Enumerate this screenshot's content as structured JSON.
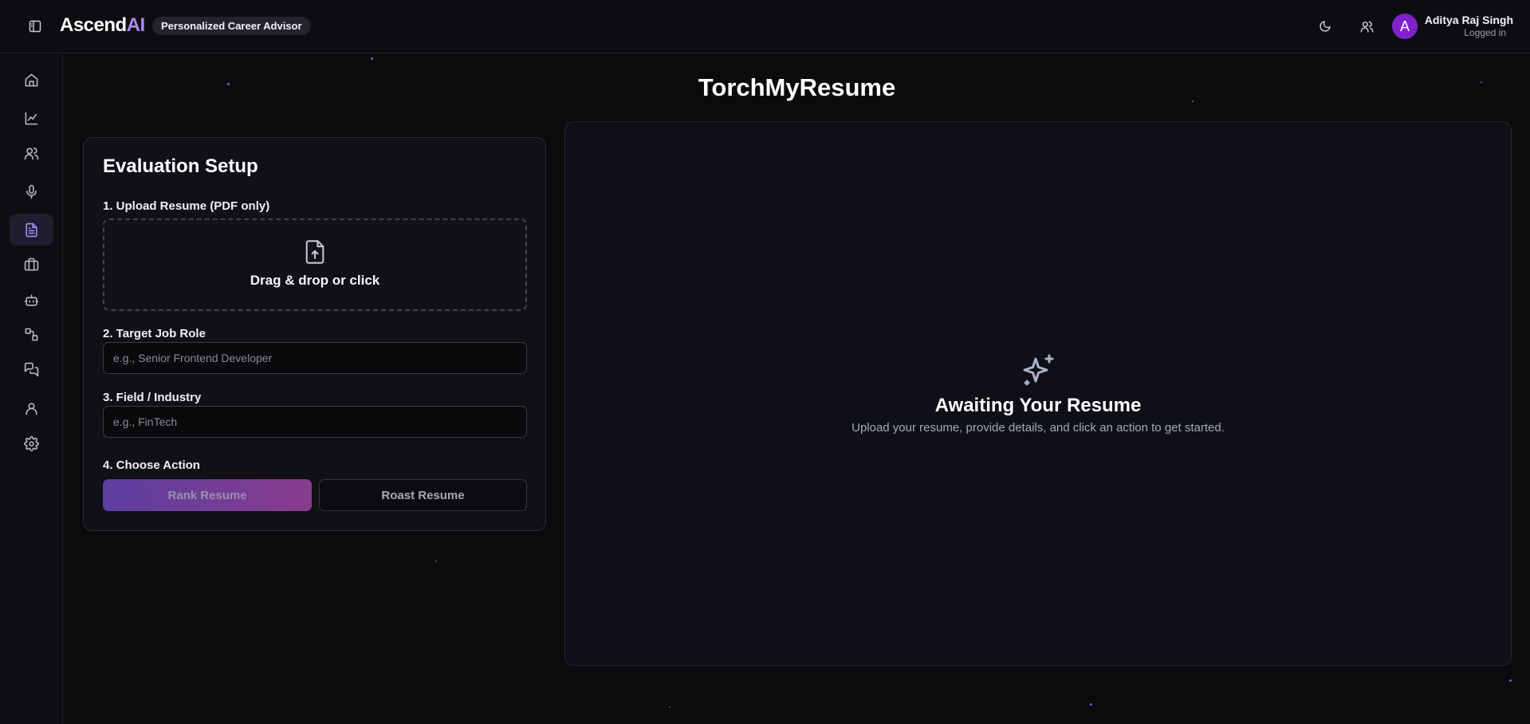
{
  "header": {
    "logo_main": "Ascend",
    "logo_accent": "AI",
    "tagline": "Personalized Career Advisor",
    "icons": [
      "sidebar-toggle-icon",
      "moon-icon",
      "users-icon"
    ],
    "user": {
      "avatar_initial": "A",
      "name": "Aditya Raj Singh",
      "status": "Logged in",
      "avatar_color": "#7e22ce"
    }
  },
  "sidebar": {
    "items": [
      {
        "icon": "home-icon"
      },
      {
        "icon": "chart-line-icon"
      },
      {
        "icon": "users-icon"
      },
      {
        "icon": "microphone-icon"
      },
      {
        "icon": "file-text-icon",
        "active": true
      },
      {
        "icon": "briefcase-icon"
      },
      {
        "icon": "bot-icon"
      },
      {
        "icon": "shapes-icon"
      },
      {
        "icon": "messages-icon"
      },
      {
        "icon": "user-icon"
      },
      {
        "icon": "settings-icon"
      }
    ],
    "accent": "#a78bfa"
  },
  "main": {
    "title": "TorchMyResume",
    "setup": {
      "title": "Evaluation Setup",
      "upload_label": "1. Upload Resume (PDF only)",
      "dropzone_text": "Drag & drop or click",
      "job_role_label": "2. Target Job Role",
      "job_role_placeholder": "e.g., Senior Frontend Developer",
      "job_role_value": "",
      "industry_label": "3. Field / Industry",
      "industry_placeholder": "e.g., FinTech",
      "industry_value": "",
      "action_label": "4. Choose Action",
      "rank_button": "Rank Resume",
      "roast_button": "Roast Resume"
    },
    "result": {
      "icon": "sparkles-icon",
      "title": "Awaiting Your Resume",
      "text": "Upload your resume, provide details, and click an action to get started."
    }
  }
}
